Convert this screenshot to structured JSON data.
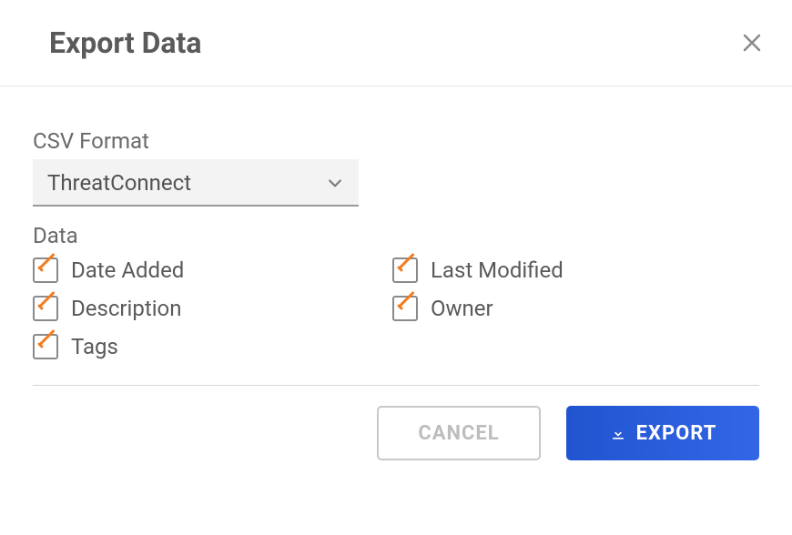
{
  "modal": {
    "title": "Export Data"
  },
  "fields": {
    "format_label": "CSV Format",
    "format_value": "ThreatConnect",
    "data_label": "Data"
  },
  "checkboxes": {
    "col1": [
      {
        "label": "Date Added"
      },
      {
        "label": "Description"
      },
      {
        "label": "Tags"
      }
    ],
    "col2": [
      {
        "label": "Last Modified"
      },
      {
        "label": "Owner"
      }
    ]
  },
  "buttons": {
    "cancel": "CANCEL",
    "export": "EXPORT"
  }
}
